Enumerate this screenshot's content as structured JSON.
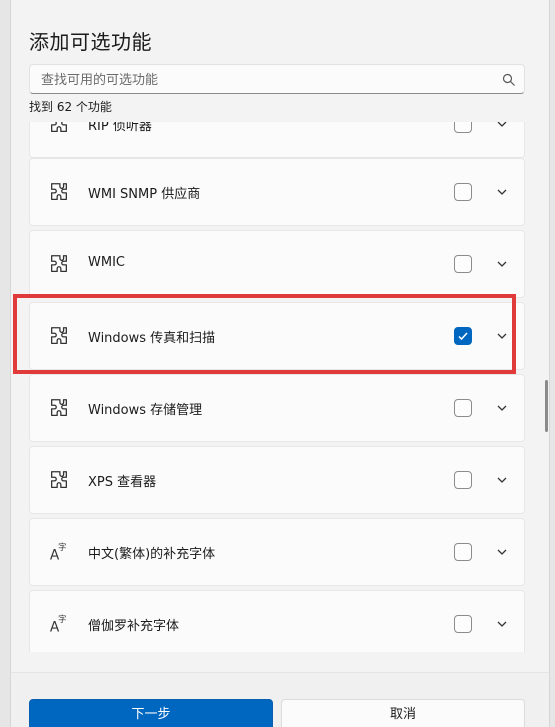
{
  "dialog": {
    "title": "添加可选功能",
    "search_placeholder": "查找可用的可选功能",
    "count_label": "找到 62 个功能"
  },
  "features": [
    {
      "label": "RIP 侦听器",
      "icon": "puzzle-icon",
      "checked": false
    },
    {
      "label": "WMI SNMP 供应商",
      "icon": "puzzle-icon",
      "checked": false
    },
    {
      "label": "WMIC",
      "icon": "puzzle-icon",
      "checked": false
    },
    {
      "label": "Windows 传真和扫描",
      "icon": "puzzle-icon",
      "checked": true
    },
    {
      "label": "Windows 存储管理",
      "icon": "puzzle-icon",
      "checked": false
    },
    {
      "label": "XPS 查看器",
      "icon": "puzzle-icon",
      "checked": false
    },
    {
      "label": "中文(繁体)的补充字体",
      "icon": "font-icon",
      "checked": false
    },
    {
      "label": "僧伽罗补充字体",
      "icon": "font-icon",
      "checked": false
    }
  ],
  "footer": {
    "next_label": "下一步",
    "cancel_label": "取消"
  },
  "colors": {
    "accent": "#0067c0",
    "highlight": "#e03a3a"
  }
}
